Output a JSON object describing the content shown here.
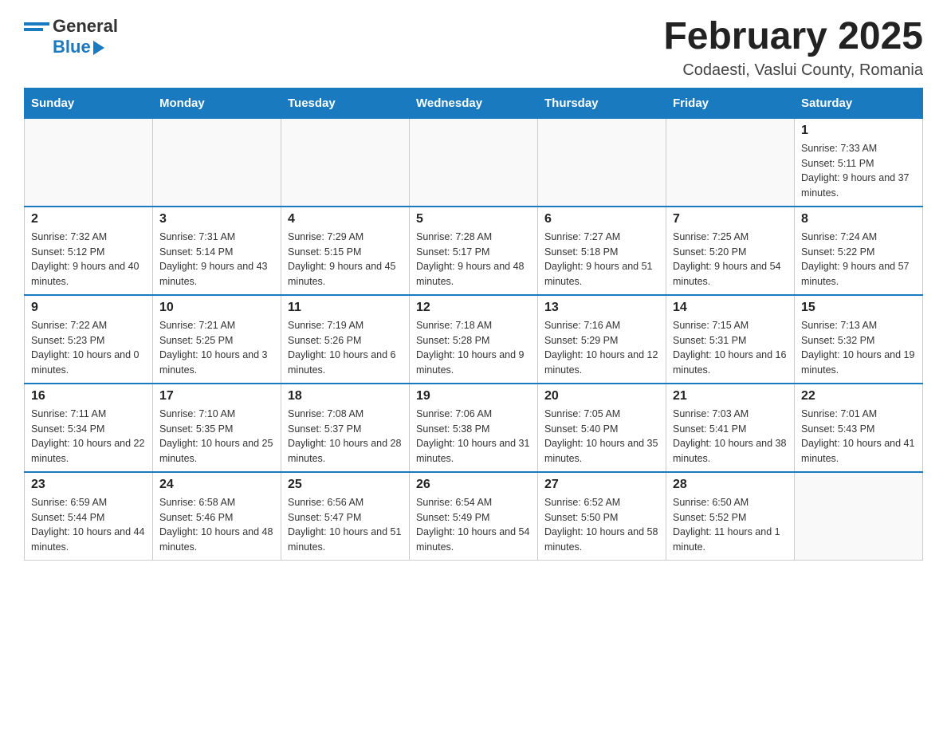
{
  "header": {
    "month_title": "February 2025",
    "location": "Codaesti, Vaslui County, Romania",
    "logo_general": "General",
    "logo_blue": "Blue"
  },
  "weekdays": [
    "Sunday",
    "Monday",
    "Tuesday",
    "Wednesday",
    "Thursday",
    "Friday",
    "Saturday"
  ],
  "weeks": [
    {
      "days": [
        {
          "date": "",
          "info": ""
        },
        {
          "date": "",
          "info": ""
        },
        {
          "date": "",
          "info": ""
        },
        {
          "date": "",
          "info": ""
        },
        {
          "date": "",
          "info": ""
        },
        {
          "date": "",
          "info": ""
        },
        {
          "date": "1",
          "info": "Sunrise: 7:33 AM\nSunset: 5:11 PM\nDaylight: 9 hours and 37 minutes."
        }
      ]
    },
    {
      "days": [
        {
          "date": "2",
          "info": "Sunrise: 7:32 AM\nSunset: 5:12 PM\nDaylight: 9 hours and 40 minutes."
        },
        {
          "date": "3",
          "info": "Sunrise: 7:31 AM\nSunset: 5:14 PM\nDaylight: 9 hours and 43 minutes."
        },
        {
          "date": "4",
          "info": "Sunrise: 7:29 AM\nSunset: 5:15 PM\nDaylight: 9 hours and 45 minutes."
        },
        {
          "date": "5",
          "info": "Sunrise: 7:28 AM\nSunset: 5:17 PM\nDaylight: 9 hours and 48 minutes."
        },
        {
          "date": "6",
          "info": "Sunrise: 7:27 AM\nSunset: 5:18 PM\nDaylight: 9 hours and 51 minutes."
        },
        {
          "date": "7",
          "info": "Sunrise: 7:25 AM\nSunset: 5:20 PM\nDaylight: 9 hours and 54 minutes."
        },
        {
          "date": "8",
          "info": "Sunrise: 7:24 AM\nSunset: 5:22 PM\nDaylight: 9 hours and 57 minutes."
        }
      ]
    },
    {
      "days": [
        {
          "date": "9",
          "info": "Sunrise: 7:22 AM\nSunset: 5:23 PM\nDaylight: 10 hours and 0 minutes."
        },
        {
          "date": "10",
          "info": "Sunrise: 7:21 AM\nSunset: 5:25 PM\nDaylight: 10 hours and 3 minutes."
        },
        {
          "date": "11",
          "info": "Sunrise: 7:19 AM\nSunset: 5:26 PM\nDaylight: 10 hours and 6 minutes."
        },
        {
          "date": "12",
          "info": "Sunrise: 7:18 AM\nSunset: 5:28 PM\nDaylight: 10 hours and 9 minutes."
        },
        {
          "date": "13",
          "info": "Sunrise: 7:16 AM\nSunset: 5:29 PM\nDaylight: 10 hours and 12 minutes."
        },
        {
          "date": "14",
          "info": "Sunrise: 7:15 AM\nSunset: 5:31 PM\nDaylight: 10 hours and 16 minutes."
        },
        {
          "date": "15",
          "info": "Sunrise: 7:13 AM\nSunset: 5:32 PM\nDaylight: 10 hours and 19 minutes."
        }
      ]
    },
    {
      "days": [
        {
          "date": "16",
          "info": "Sunrise: 7:11 AM\nSunset: 5:34 PM\nDaylight: 10 hours and 22 minutes."
        },
        {
          "date": "17",
          "info": "Sunrise: 7:10 AM\nSunset: 5:35 PM\nDaylight: 10 hours and 25 minutes."
        },
        {
          "date": "18",
          "info": "Sunrise: 7:08 AM\nSunset: 5:37 PM\nDaylight: 10 hours and 28 minutes."
        },
        {
          "date": "19",
          "info": "Sunrise: 7:06 AM\nSunset: 5:38 PM\nDaylight: 10 hours and 31 minutes."
        },
        {
          "date": "20",
          "info": "Sunrise: 7:05 AM\nSunset: 5:40 PM\nDaylight: 10 hours and 35 minutes."
        },
        {
          "date": "21",
          "info": "Sunrise: 7:03 AM\nSunset: 5:41 PM\nDaylight: 10 hours and 38 minutes."
        },
        {
          "date": "22",
          "info": "Sunrise: 7:01 AM\nSunset: 5:43 PM\nDaylight: 10 hours and 41 minutes."
        }
      ]
    },
    {
      "days": [
        {
          "date": "23",
          "info": "Sunrise: 6:59 AM\nSunset: 5:44 PM\nDaylight: 10 hours and 44 minutes."
        },
        {
          "date": "24",
          "info": "Sunrise: 6:58 AM\nSunset: 5:46 PM\nDaylight: 10 hours and 48 minutes."
        },
        {
          "date": "25",
          "info": "Sunrise: 6:56 AM\nSunset: 5:47 PM\nDaylight: 10 hours and 51 minutes."
        },
        {
          "date": "26",
          "info": "Sunrise: 6:54 AM\nSunset: 5:49 PM\nDaylight: 10 hours and 54 minutes."
        },
        {
          "date": "27",
          "info": "Sunrise: 6:52 AM\nSunset: 5:50 PM\nDaylight: 10 hours and 58 minutes."
        },
        {
          "date": "28",
          "info": "Sunrise: 6:50 AM\nSunset: 5:52 PM\nDaylight: 11 hours and 1 minute."
        },
        {
          "date": "",
          "info": ""
        }
      ]
    }
  ]
}
